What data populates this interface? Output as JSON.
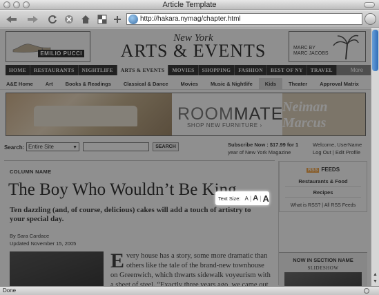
{
  "window": {
    "title": "Article Template"
  },
  "browser": {
    "url": "http://hakara.nymag/chapter.html",
    "status": "Done",
    "icons": [
      "back-arrow-icon",
      "forward-arrow-icon",
      "reload-icon",
      "stop-icon",
      "home-icon",
      "bookmark-icon",
      "globe-icon",
      "go-icon"
    ]
  },
  "masthead": {
    "brand": "New York",
    "title": "ARTS & EVENTS",
    "ad_left_brand": "EMILIO PUCCI",
    "ad_right_text": "MARC BY\nMARC JACOBS"
  },
  "mainnav": {
    "items": [
      "HOME",
      "RESTAURANTS",
      "NIGHTLIFE",
      "ARTS & EVENTS",
      "MOVIES",
      "SHOPPING",
      "FASHION",
      "BEST OF NY",
      "TRAVEL"
    ],
    "active": "ARTS & EVENTS",
    "more": "More"
  },
  "subnav": {
    "items": [
      "A&E Home",
      "Art",
      "Books & Readings",
      "Classical & Dance",
      "Movies",
      "Music & Nightlife",
      "Kids",
      "Theater",
      "Approval Matrix"
    ],
    "active": "Kids"
  },
  "banner": {
    "room": "ROOM",
    "mates": "MATES",
    "shop": "SHOP NEW FURNITURE ›",
    "store": "Neiman Marcus"
  },
  "search": {
    "label": "Search:",
    "scope": "Entire Site",
    "button": "SEARCH",
    "subscribe_line1": "Subscribe Now : $17.99 for 1",
    "subscribe_line2": "year of New York Magazine",
    "welcome": "Welcome, UserName",
    "logout": "Log Out",
    "sep": " | ",
    "edit_profile": "Edit Profile"
  },
  "article": {
    "column_name": "COLUMN NAME",
    "text_size_label": "Text Size:",
    "size_small": "A",
    "size_medium": "A",
    "size_large": "A",
    "headline": "The Boy Who Wouldn’t Be King",
    "deck": "Ten dazzling (and, of course, delicious) cakes will add a touch of artistry to your special day.",
    "byline": "By Sara Cardace",
    "updated": "Updated November 15, 2005",
    "dropcap": "E",
    "body": "very house has a story, some more dramatic than others like the tale of the brand-new townhouse on Greenwich, which thwarts sidewalk voyeurism with a sheet of steel. “Exactly three years ago, we came out of"
  },
  "sidebar": {
    "rss_badge": "RSS",
    "feeds_title": "FEEDS",
    "feeds": [
      "Restaurants & Food",
      "Recipes"
    ],
    "what_is_rss": "What is RSS?",
    "all_rss": "All RSS Feeds",
    "link_sep": "|",
    "section_title": "NOW IN SECTION NAME",
    "slideshow": "SLIDESHOW"
  },
  "colors": {
    "nav_bg": "#1b1b1b",
    "rss_orange": "#f29a2e",
    "scroll_blue": "#2f6cb8",
    "dim_overlay": "rgba(40,40,40,0.52)"
  }
}
